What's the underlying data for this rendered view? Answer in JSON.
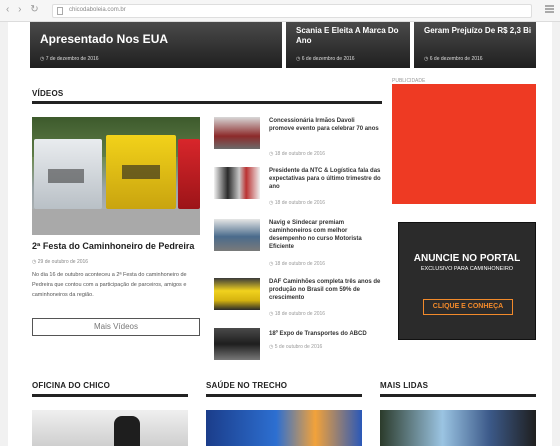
{
  "browser": {
    "nav_glyphs": "‹ › ↻",
    "url": "chicodaboleia.com.br"
  },
  "slider": [
    {
      "title": "Apresentado Nos EUA",
      "date": "7 de dezembro de 2016"
    },
    {
      "title": "Scania E Eleita A Marca Do Ano",
      "date": "6 de dezembro de 2016"
    },
    {
      "title": "Geram Prejuízo De R$ 2,3 Bi",
      "date": "6 de dezembro de 2016"
    }
  ],
  "videos": {
    "heading": "VÍDEOS",
    "featured": {
      "title": "2ª Festa do Caminhoneiro de Pedreira",
      "date": "29 de outubro de 2016",
      "description": "No dia 16 de outubro aconteceu a 2ª Festa do caminhoneiro de Pedreira que contou com a participação de parceiros, amigos e caminhoneiros da região."
    },
    "items": [
      {
        "title": "Concessionária Irmãos Davoli promove evento para celebrar 70 anos",
        "date": "18 de outubro de 2016"
      },
      {
        "title": "Presidente da NTC & Logística fala das expectativas para o último trimestre do ano",
        "date": "18 de outubro de 2016"
      },
      {
        "title": "Navig e Sindecar premiam caminhoneiros com melhor desempenho no curso Motorista Eficiente",
        "date": "18 de outubro de 2016"
      },
      {
        "title": "DAF Caminhões completa três anos de produção no Brasil com 59% de crescimento",
        "date": "18 de outubro de 2016"
      },
      {
        "title": "18º Expo de Transportes do ABCD",
        "date": "5 de outubro de 2016"
      }
    ],
    "more_label": "Mais Vídeos"
  },
  "ads": {
    "label": "PUBLICIDADE",
    "portal_title": "ANUNCIE NO PORTAL",
    "portal_subtitle": "EXCLUSIVO PARA CAMINHONEIRO",
    "portal_cta": "CLIQUE E CONHEÇA"
  },
  "sections": {
    "oficina": "OFICINA DO CHICO",
    "saude": "SAÚDE NO TRECHO",
    "mais_lidas": "MAIS LIDAS"
  },
  "colors": {
    "ad_red": "#ee3a23",
    "cta_orange": "#f28a2b"
  }
}
